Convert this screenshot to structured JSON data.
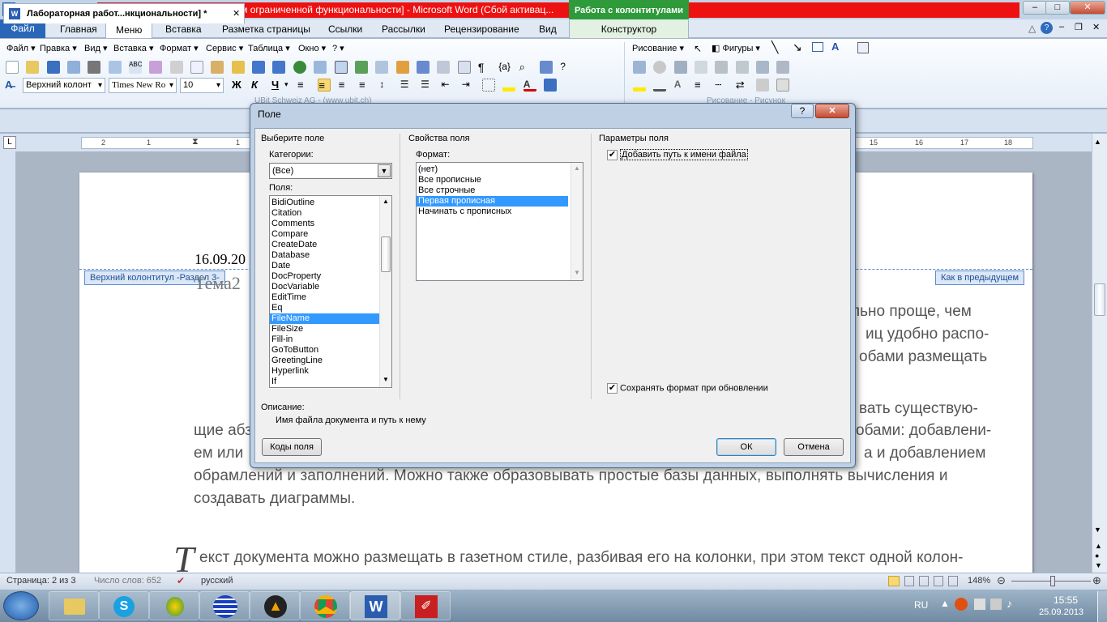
{
  "window": {
    "title": "Лабораторная работа 1 [Режим ограниченной функциональности]  -  Microsoft Word (Сбой активац...",
    "context_tab_group": "Работа с колонтитулами",
    "minimize": "–",
    "maximize": "□",
    "close": "✕"
  },
  "ribbon_tabs": {
    "file": "Файл",
    "home": "Главная",
    "menu": "Меню",
    "insert": "Вставка",
    "layout": "Разметка страницы",
    "references": "Ссылки",
    "mailings": "Рассылки",
    "review": "Рецензирование",
    "view": "Вид",
    "constructor": "Конструктор"
  },
  "classic_menu": {
    "file": "Файл",
    "edit": "Правка",
    "view": "Вид",
    "insert": "Вставка",
    "format": "Формат",
    "service": "Сервис",
    "table": "Таблица",
    "window": "Окно",
    "help": "?",
    "drawing": "Рисование",
    "shapes": "Фигуры"
  },
  "format_bar": {
    "style": "Верхний колонт",
    "font": "Times New Ro",
    "size": "10",
    "bold": "Ж",
    "italic": "К",
    "underline": "Ч"
  },
  "group_labels": {
    "left": "UBit Schweiz AG - (www.ubit.ch)",
    "right": "Рисование - Рисунок"
  },
  "document_tab": {
    "title": "Лабораторная работ...нкциональности]  *"
  },
  "ruler": {
    "left_ticks": [
      "2",
      "1",
      "1",
      "2"
    ],
    "right_ticks": [
      "15",
      "16",
      "17",
      "18"
    ]
  },
  "document": {
    "date": "16.09.20",
    "header_label": "Верхний колонтитул -Раздел 3-",
    "same_as_previous": "Как в предыдущем",
    "tema": "Тема2",
    "right_lines": [
      "льно  проще,  чем",
      "иц удобно распо-",
      "обами  размещать"
    ],
    "mid_right": "вать существую-",
    "line1": "щие абз",
    "line1_right": "обами: добавлени-",
    "line2": "ем или",
    "line2_right": "а и добавлением",
    "line3": "обрамлений и заполнений. Можно также образовывать простые базы данных, выполнять вычисления и",
    "line4": "создавать диаграммы.",
    "dropcap": "Т",
    "last_line": "екст документа можно размещать в газетном стиле, разбивая его на колонки, при этом текст одной колон-"
  },
  "statusbar": {
    "page": "Страница: 2 из 3",
    "words": "Число слов: 652",
    "language": "русский",
    "zoom": "148%"
  },
  "taskbar": {
    "language": "RU",
    "time": "15:55",
    "date": "25.09.2013"
  },
  "dialog": {
    "title": "Поле",
    "help": "?",
    "close": "✕",
    "choose_field": "Выберите поле",
    "categories_label": "Категории:",
    "category_value": "(Все)",
    "fields_label": "Поля:",
    "fields": [
      "BidiOutline",
      "Citation",
      "Comments",
      "Compare",
      "CreateDate",
      "Database",
      "Date",
      "DocProperty",
      "DocVariable",
      "EditTime",
      "Eq",
      "FileName",
      "FileSize",
      "Fill-in",
      "GoToButton",
      "GreetingLine",
      "Hyperlink",
      "If"
    ],
    "selected_field": "FileName",
    "field_props": "Свойства поля",
    "format_label": "Формат:",
    "formats": [
      "(нет)",
      "Все прописные",
      "Все строчные",
      "Первая прописная",
      "Начинать с прописных"
    ],
    "selected_format": "Первая прописная",
    "field_params": "Параметры поля",
    "add_path": "Добавить путь к имени файла",
    "keep_format": "Сохранять формат при обновлении",
    "description_label": "Описание:",
    "description": "Имя файла документа и путь к нему",
    "field_codes": "Коды поля",
    "ok": "ОК",
    "cancel": "Отмена"
  }
}
